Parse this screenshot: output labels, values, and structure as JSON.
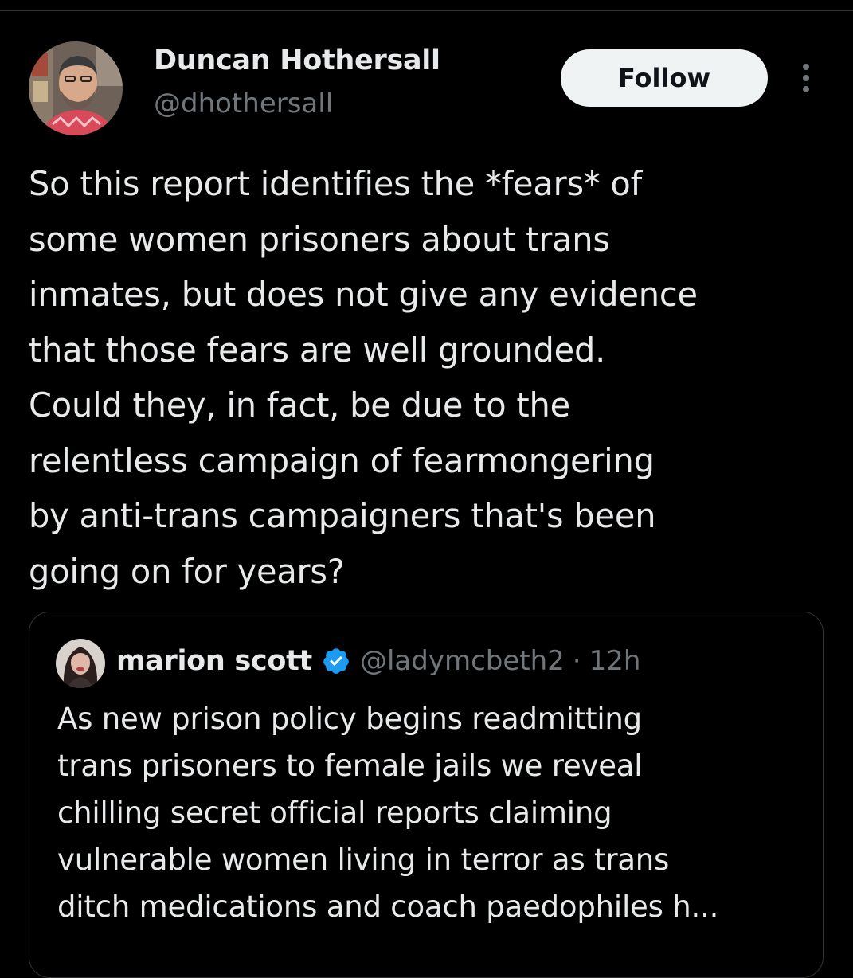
{
  "author": {
    "name": "Duncan Hothersall",
    "handle": "@dhothersall",
    "avatar_icon": "person-photo-icon"
  },
  "follow_button": {
    "label": "Follow"
  },
  "more_icon": "more-vertical-icon",
  "tweet": {
    "lines": [
      "So this report identifies the *fears* of",
      "some women prisoners about trans",
      "inmates, but does not give any evidence",
      "that those fears are well grounded.",
      "Could they, in fact, be due to the",
      "relentless campaign of fearmongering",
      "by anti-trans campaigners that's been",
      "going on for years?"
    ]
  },
  "quoted_tweet": {
    "name": "marion scott",
    "verified_icon": "verified-badge-icon",
    "handle": "@ladymcbeth2",
    "separator": "·",
    "time": "12h",
    "lines": [
      "As new prison policy begins readmitting",
      "trans prisoners to female jails we reveal",
      "chilling secret official reports claiming",
      "vulnerable women living in terror as trans",
      "ditch medications and coach paedophiles h..."
    ]
  },
  "colors": {
    "background": "#000000",
    "primary_text": "#e7e9ea",
    "secondary_text": "#71767b",
    "border": "#2f3336",
    "follow_bg": "#eff3f4",
    "verified_blue": "#1d9bf0"
  }
}
